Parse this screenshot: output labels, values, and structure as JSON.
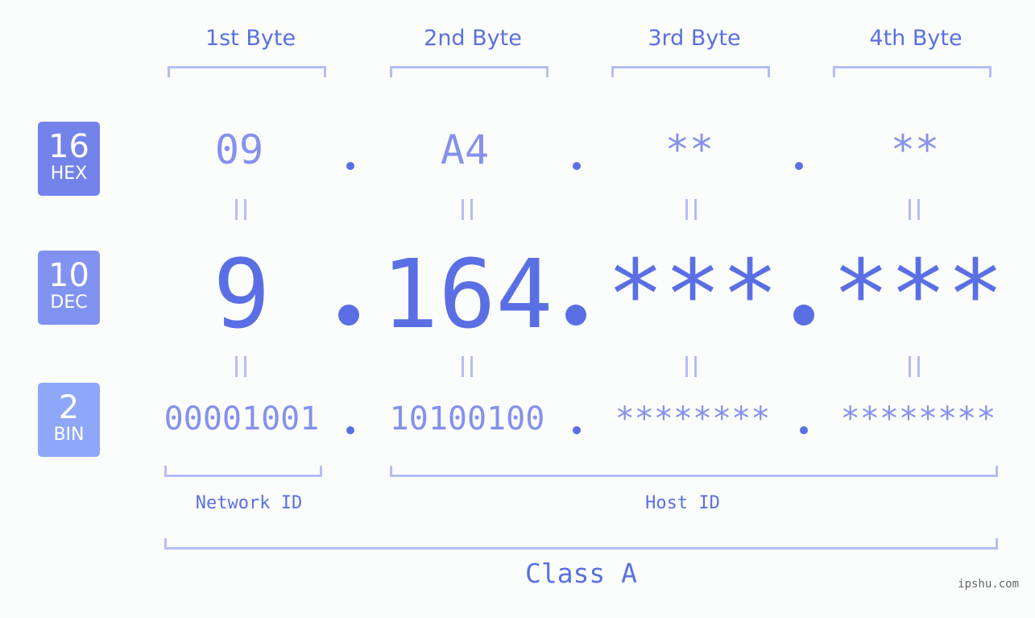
{
  "bases": [
    {
      "number": "16",
      "label": "HEX",
      "color": "#7383ea"
    },
    {
      "number": "10",
      "label": "DEC",
      "color": "#8192f1"
    },
    {
      "number": "2",
      "label": "BIN",
      "color": "#8fa7f8"
    }
  ],
  "byte_headers": [
    "1st Byte",
    "2nd Byte",
    "3rd Byte",
    "4th Byte"
  ],
  "hex": [
    "09",
    "A4",
    "**",
    "**"
  ],
  "dec": [
    "9",
    "164",
    "***",
    "***"
  ],
  "bin": [
    "00001001",
    "10100100",
    "********",
    "********"
  ],
  "network_id_label": "Network ID",
  "host_id_label": "Host ID",
  "class_label": "Class A",
  "watermark": "ipshu.com",
  "colors": {
    "accent": "#5a6fe4",
    "light": "#8590ee",
    "bracket": "#b4bdf6"
  }
}
